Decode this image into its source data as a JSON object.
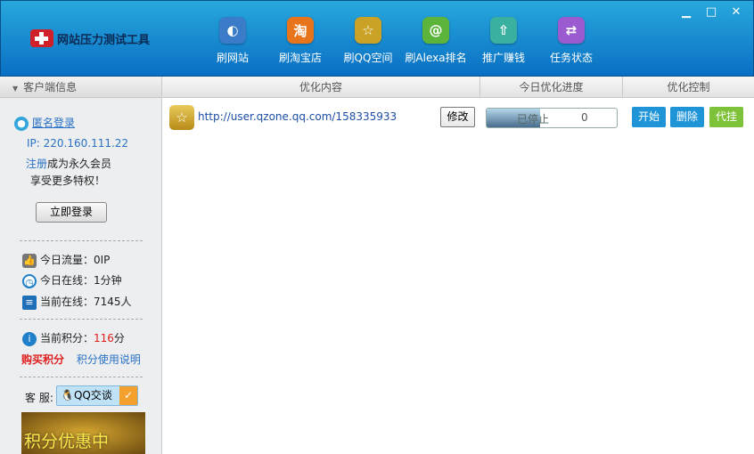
{
  "app": {
    "title": "网站压力测试工具"
  },
  "nav": [
    {
      "label": "刷网站",
      "icon": "globe-icon",
      "color": "#3a7cc8",
      "glyph": "◐"
    },
    {
      "label": "刷淘宝店",
      "icon": "taobao-icon",
      "color": "#e8751c",
      "glyph": "淘"
    },
    {
      "label": "刷QQ空间",
      "icon": "qzone-star-icon",
      "color": "#c9a226",
      "glyph": "☆"
    },
    {
      "label": "刷Alexa排名",
      "icon": "alexa-icon",
      "color": "#5cb53a",
      "glyph": "@"
    },
    {
      "label": "推广赚钱",
      "icon": "rocket-icon",
      "color": "#3ab0a0",
      "glyph": "⇧"
    },
    {
      "label": "任务状态",
      "icon": "task-arrows-icon",
      "color": "#9a5ad0",
      "glyph": "⇄"
    }
  ],
  "window": {
    "minimize": "▁",
    "maximize": "□",
    "close": "✕"
  },
  "sidebar": {
    "title": "客户端信息",
    "user": "匿名登录",
    "ip": "IP: 220.160.111.22",
    "register_link": "注册",
    "register_text": "成为永久会员",
    "privilege": "享受更多特权！",
    "login_button": "立即登录",
    "traffic": "今日流量：0IP",
    "online_time": "今日在线：1分钟",
    "online_users": "当前在线：7145人",
    "points_label": "当前积分：",
    "points_value": "116",
    "points_unit": "分",
    "buy_points": "购买积分",
    "points_help": "积分使用说明",
    "service_label": "客 服:",
    "qq_chat": "QQ交谈",
    "banner": "积分优惠中"
  },
  "table": {
    "headers": [
      "优化内容",
      "今日优化进度",
      "优化控制"
    ],
    "rows": [
      {
        "url": "http://user.qzone.qq.com/158335933",
        "edit": "修改",
        "status": "已停止",
        "count": "0",
        "progress_fraction": 0.41,
        "start": "开始",
        "delete": "删除",
        "proxy": "代挂"
      }
    ]
  },
  "colors": {
    "start": "#1f95d8",
    "delete": "#1f95d8",
    "proxy": "#7ec23a",
    "points": "#e02020",
    "buy": "#e02020"
  }
}
